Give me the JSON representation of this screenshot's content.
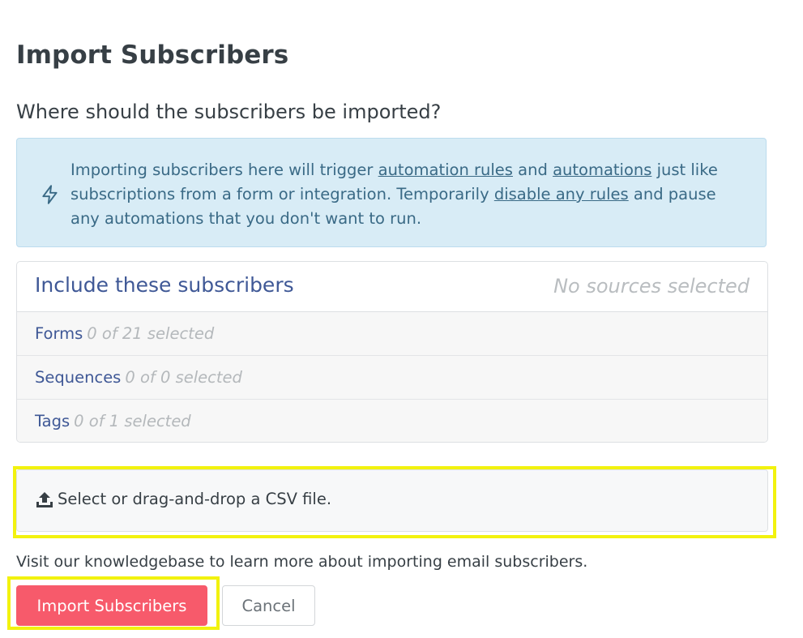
{
  "page": {
    "title": "Import Subscribers",
    "question": "Where should the subscribers be imported?"
  },
  "notice": {
    "icon": "lightning-icon",
    "text_1": "Importing subscribers here will trigger ",
    "link_automation_rules": "automation rules",
    "text_2": " and ",
    "link_automations": "automations",
    "text_3": " just like subscriptions from a form or integration. Temporarily ",
    "link_disable_rules": "disable any rules",
    "text_4": " and pause any automations that you don't want to run."
  },
  "sources": {
    "title": "Include these subscribers",
    "status": "No sources selected",
    "rows": [
      {
        "name": "Forms",
        "count": "0 of 21 selected"
      },
      {
        "name": "Sequences",
        "count": "0 of 0 selected"
      },
      {
        "name": "Tags",
        "count": "0 of 1 selected"
      }
    ]
  },
  "upload": {
    "icon": "upload-icon",
    "label": "Select or drag-and-drop a CSV file."
  },
  "knowledgebase_text": "Visit our knowledgebase to learn more about importing email subscribers.",
  "actions": {
    "import_label": "Import Subscribers",
    "cancel_label": "Cancel"
  },
  "colors": {
    "primary_button": "#f75a6b",
    "notice_background": "#d8ecf6",
    "link_blue": "#3f5896",
    "highlight": "#f2f20e"
  }
}
